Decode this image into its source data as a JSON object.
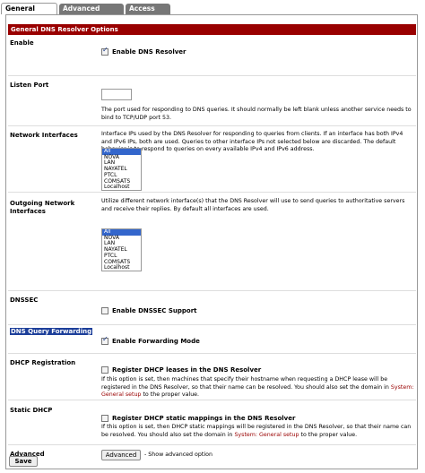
{
  "tabs": [
    {
      "label": "General settings",
      "active": true
    },
    {
      "label": "Advanced settings",
      "active": false
    },
    {
      "label": "Access Lists",
      "active": false
    }
  ],
  "section_title": "General DNS Resolver Options",
  "enable": {
    "label": "Enable",
    "checkbox_label": "Enable DNS Resolver",
    "checked": true
  },
  "listen_port": {
    "label": "Listen Port",
    "value": "",
    "description": "The port used for responding to DNS queries. It should normally be left blank unless another service needs to bind to TCP/UDP port 53."
  },
  "network_interfaces": {
    "label": "Network Interfaces",
    "description": "Interface IPs used by the DNS Resolver for responding to queries from clients. If an interface has both IPv4 and IPv6 IPs, both are used. Queries to other interface IPs not selected below are discarded. The default behavior is to respond to queries on every available IPv4 and IPv6 address.",
    "options": [
      "All",
      "NOVA",
      "LAN",
      "NAYATEL",
      "PTCL",
      "COMSATS",
      "Localhost"
    ],
    "selected": "All"
  },
  "outgoing_interfaces": {
    "label": "Outgoing Network Interfaces",
    "description": "Utilize different network interface(s) that the DNS Resolver will use to send queries to authoritative servers and receive their replies. By default all interfaces are used.",
    "options": [
      "All",
      "NOVA",
      "LAN",
      "NAYATEL",
      "PTCL",
      "COMSATS",
      "Localhost"
    ],
    "selected": "All"
  },
  "dnssec": {
    "label": "DNSSEC",
    "checkbox_label": "Enable DNSSEC Support",
    "checked": false
  },
  "forwarding": {
    "label": "DNS Query Forwarding",
    "checkbox_label": "Enable Forwarding Mode",
    "checked": true
  },
  "dhcp_registration": {
    "label": "DHCP Registration",
    "checkbox_label": "Register DHCP leases in the DNS Resolver",
    "checked": false,
    "description_pre": "If this option is set, then machines that specify their hostname when requesting a DHCP lease will be registered in the DNS Resolver, so that their name can be resolved. You should also set the domain in ",
    "link": "System: General setup",
    "description_post": " to the proper value."
  },
  "static_dhcp": {
    "label": "Static DHCP",
    "checkbox_label": "Register DHCP static mappings in the DNS Resolver",
    "checked": false,
    "description_pre": "If this option is set, then DHCP static mappings will be registered in the DNS Resolver, so that their name can be resolved. You should also set the domain in ",
    "link": "System: General setup",
    "description_post": " to the proper value."
  },
  "advanced": {
    "label": "Advanced",
    "button_label": "Advanced",
    "hint": "- Show advanced option"
  },
  "save_label": "Save",
  "colors": {
    "header_bg": "#990000",
    "tab_inactive_bg": "#777777",
    "link": "#990000",
    "highlight": "#1d3f9a"
  }
}
